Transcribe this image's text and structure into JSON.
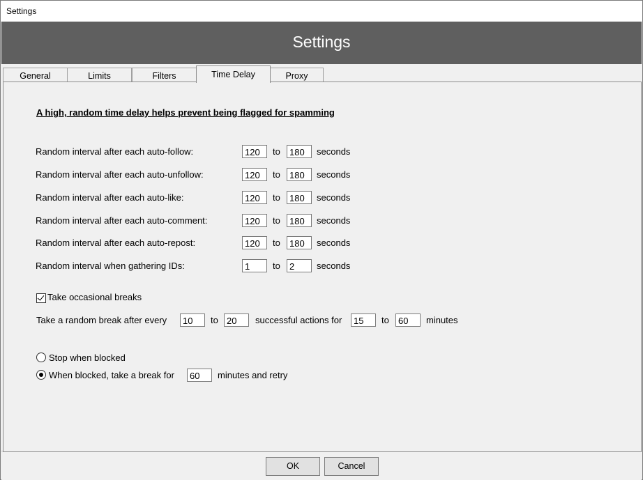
{
  "window": {
    "title": "Settings"
  },
  "header": {
    "title": "Settings"
  },
  "tabs": [
    {
      "label": "General"
    },
    {
      "label": "Limits"
    },
    {
      "label": "Filters"
    },
    {
      "label": "Time Delay"
    },
    {
      "label": "Proxy"
    }
  ],
  "active_tab": "Time Delay",
  "time_delay": {
    "heading": "A high, random time delay helps prevent being flagged for spamming",
    "to_label": "to",
    "seconds_label": "seconds",
    "rows": [
      {
        "label": "Random interval after each auto-follow:",
        "min": "120",
        "max": "180"
      },
      {
        "label": "Random interval after each auto-unfollow:",
        "min": "120",
        "max": "180"
      },
      {
        "label": "Random interval after each auto-like:",
        "min": "120",
        "max": "180"
      },
      {
        "label": "Random interval after each auto-comment:",
        "min": "120",
        "max": "180"
      },
      {
        "label": "Random interval after each auto-repost:",
        "min": "120",
        "max": "180"
      },
      {
        "label": "Random interval when gathering IDs:",
        "min": "1",
        "max": "2"
      }
    ],
    "breaks": {
      "checkbox_label": "Take occasional breaks",
      "checked": true,
      "prefix": "Take a random break after every",
      "actions_min": "10",
      "actions_max": "20",
      "middle": "successful actions for",
      "minutes_min": "15",
      "minutes_max": "60",
      "suffix": "minutes"
    },
    "blocked": {
      "stop_label": "Stop when blocked",
      "stop_selected": false,
      "retry_label": "When blocked, take a break for",
      "retry_selected": true,
      "retry_minutes": "60",
      "retry_suffix": "minutes and retry"
    }
  },
  "footer": {
    "ok_label": "OK",
    "cancel_label": "Cancel"
  }
}
